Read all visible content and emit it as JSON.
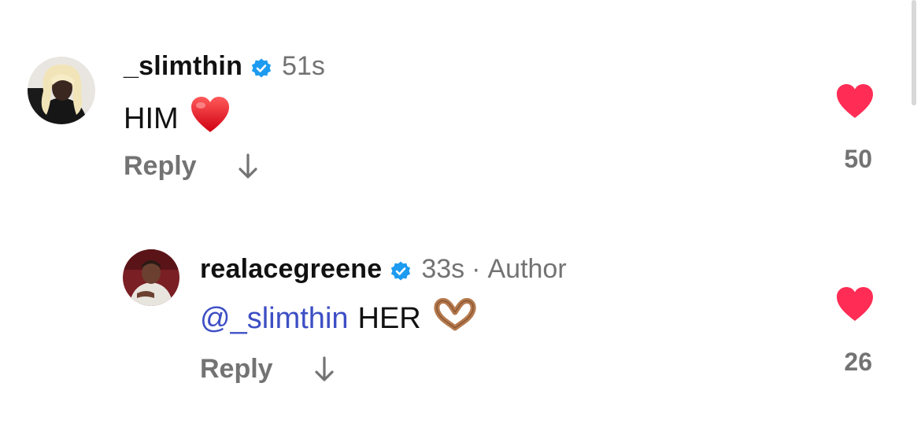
{
  "colors": {
    "verified_blue": "#1d9bf0",
    "like_red": "#ff2d55",
    "mention_blue": "#3d4fc4",
    "secondary_gray": "#737373"
  },
  "comments": [
    {
      "username": "_slimthin",
      "verified": true,
      "time": "51s",
      "text": "HIM",
      "emoji": "red-heart",
      "reply_label": "Reply",
      "likes": "50",
      "liked": true
    },
    {
      "username": "realacegreene",
      "verified": true,
      "time": "33s",
      "separator": "·",
      "author_label": "Author",
      "mention": "@_slimthin",
      "text": "HER",
      "emoji": "heart-hands",
      "reply_label": "Reply",
      "likes": "26",
      "liked": true
    }
  ]
}
